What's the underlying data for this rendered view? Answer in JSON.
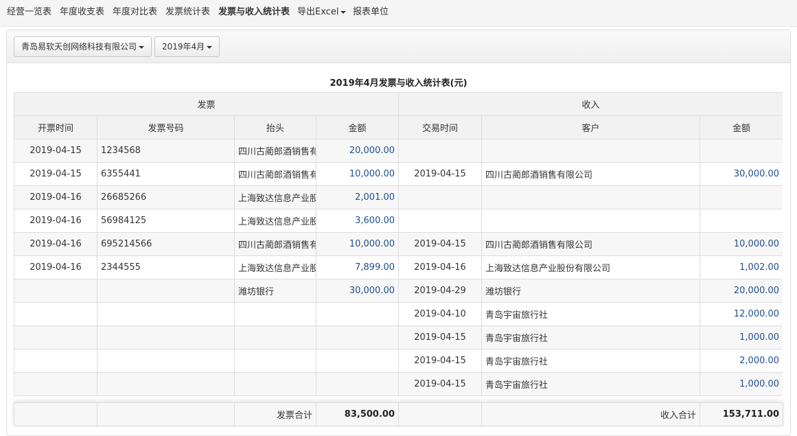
{
  "nav": [
    {
      "label": "经营一览表",
      "active": false
    },
    {
      "label": "年度收支表",
      "active": false
    },
    {
      "label": "年度对比表",
      "active": false
    },
    {
      "label": "发票统计表",
      "active": false
    },
    {
      "label": "发票与收入统计表",
      "active": true
    },
    {
      "label": "导出Excel",
      "active": false,
      "dropdown": true
    },
    {
      "label": "报表单位",
      "active": false
    }
  ],
  "filters": {
    "company": "青岛易软天创网络科技有限公司",
    "month": "2019年4月"
  },
  "report_title": "2019年4月发票与收入统计表(元)",
  "table": {
    "group_headers": {
      "invoice": "发票",
      "income": "收入"
    },
    "columns": {
      "invoice_date": "开票时间",
      "invoice_no": "发票号码",
      "invoice_title": "抬头",
      "invoice_amount": "金额",
      "trade_date": "交易时间",
      "customer": "客户",
      "income_amount": "金额"
    },
    "rows": [
      {
        "invoice_date": "2019-04-15",
        "invoice_no": "1234568",
        "invoice_title": "四川古蔺郎酒销售有限公司",
        "invoice_amount": "20,000.00",
        "trade_date": "",
        "customer": "",
        "income_amount": ""
      },
      {
        "invoice_date": "2019-04-15",
        "invoice_no": "6355441",
        "invoice_title": "四川古蔺郎酒销售有限公司",
        "invoice_amount": "10,000.00",
        "trade_date": "2019-04-15",
        "customer": "四川古蔺郎酒销售有限公司",
        "income_amount": "30,000.00"
      },
      {
        "invoice_date": "2019-04-16",
        "invoice_no": "26685266",
        "invoice_title": "上海致达信息产业股份有限公司",
        "invoice_amount": "2,001.00",
        "trade_date": "",
        "customer": "",
        "income_amount": ""
      },
      {
        "invoice_date": "2019-04-16",
        "invoice_no": "56984125",
        "invoice_title": "上海致达信息产业股份有限公司",
        "invoice_amount": "3,600.00",
        "trade_date": "",
        "customer": "",
        "income_amount": ""
      },
      {
        "invoice_date": "2019-04-16",
        "invoice_no": "695214566",
        "invoice_title": "四川古蔺郎酒销售有限公司",
        "invoice_amount": "10,000.00",
        "trade_date": "2019-04-15",
        "customer": "四川古蔺郎酒销售有限公司",
        "income_amount": "10,000.00"
      },
      {
        "invoice_date": "2019-04-16",
        "invoice_no": "2344555",
        "invoice_title": "上海致达信息产业股份有限公司",
        "invoice_amount": "7,899.00",
        "trade_date": "2019-04-16",
        "customer": "上海致达信息产业股份有限公司",
        "income_amount": "1,002.00"
      },
      {
        "invoice_date": "",
        "invoice_no": "",
        "invoice_title": "潍坊银行",
        "invoice_amount": "30,000.00",
        "trade_date": "2019-04-29",
        "customer": "潍坊银行",
        "income_amount": "20,000.00"
      },
      {
        "invoice_date": "",
        "invoice_no": "",
        "invoice_title": "",
        "invoice_amount": "",
        "trade_date": "2019-04-10",
        "customer": "青岛宇宙旅行社",
        "income_amount": "12,000.00"
      },
      {
        "invoice_date": "",
        "invoice_no": "",
        "invoice_title": "",
        "invoice_amount": "",
        "trade_date": "2019-04-15",
        "customer": "青岛宇宙旅行社",
        "income_amount": "1,000.00"
      },
      {
        "invoice_date": "",
        "invoice_no": "",
        "invoice_title": "",
        "invoice_amount": "",
        "trade_date": "2019-04-15",
        "customer": "青岛宇宙旅行社",
        "income_amount": "2,000.00"
      },
      {
        "invoice_date": "",
        "invoice_no": "",
        "invoice_title": "",
        "invoice_amount": "",
        "trade_date": "2019-04-15",
        "customer": "青岛宇宙旅行社",
        "income_amount": "1,000.00"
      }
    ]
  },
  "footer": {
    "invoice_total_label": "发票合计",
    "invoice_total": "83,500.00",
    "income_total_label": "收入合计",
    "income_total": "153,711.00"
  },
  "colors": {
    "amount": "#1f4e8c",
    "header_bg": "#f2f2f2",
    "border": "#dddddd"
  }
}
